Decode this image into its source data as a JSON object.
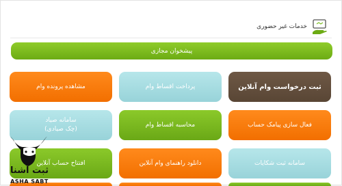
{
  "header": {
    "title": "خدمات غیر حضوری",
    "icon": "monitor-hand-icon"
  },
  "wide_button": {
    "label": "پیشخوان مجازی"
  },
  "tiles": [
    {
      "id": "register-loan",
      "label": "ثبت درخواست وام آنلاین",
      "color": "#6e5845"
    },
    {
      "id": "pay-installments",
      "label": "پرداخت اقساط وام",
      "color": "#b6e6ea"
    },
    {
      "id": "view-loan-file",
      "label": "مشاهده پرونده وام",
      "color": "#ff8a1c"
    },
    {
      "id": "sms-activation",
      "label": "فعال سازی پیامک حساب",
      "color": "#ff8a1c"
    },
    {
      "id": "calc-installments",
      "label": "محاسبه اقساط وام",
      "color": "#8bc92a"
    },
    {
      "id": "sayad-system",
      "label": "سامانه صیاد\n(چک صیادی)",
      "color": "#b6e6ea"
    },
    {
      "id": "complaints",
      "label": "سامانه ثبت شکایات",
      "color": "#b6e6ea"
    },
    {
      "id": "loan-guide",
      "label": "دانلود راهنمای وام آنلاین",
      "color": "#ff8a1c"
    },
    {
      "id": "open-account",
      "label": "افتتاح حساب آنلاین",
      "color": "#8bc92a"
    }
  ],
  "watermark": {
    "fa": "ثبت آشنا",
    "en": "ASHA SABT"
  }
}
